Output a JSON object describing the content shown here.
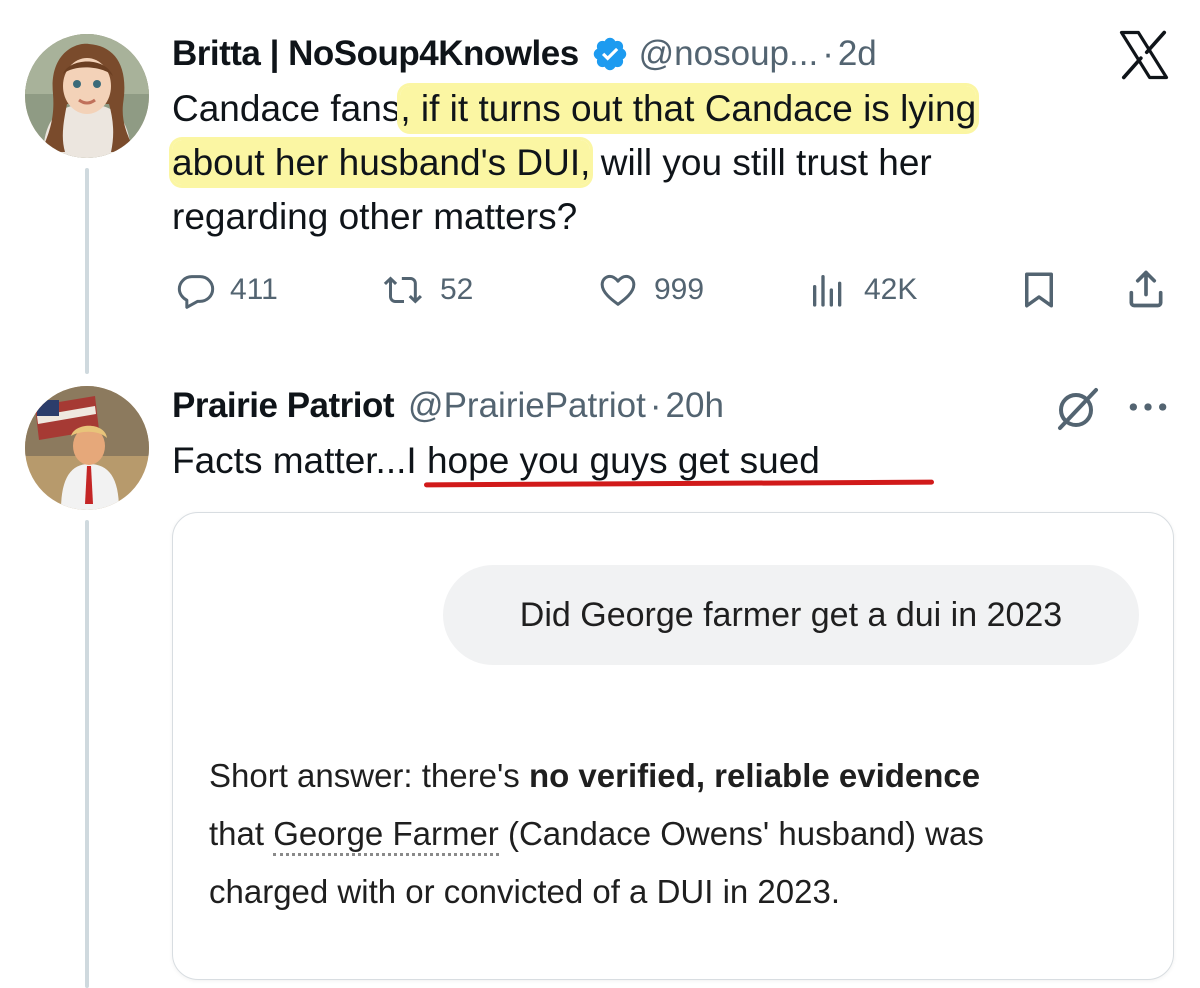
{
  "brand": {
    "logo": "X"
  },
  "tweet1": {
    "author_name": "Britta | NoSoup4Knowles",
    "handle": "@nosoup...",
    "separator": "·",
    "time": "2d",
    "verified": true,
    "text_part1": "Candace fans",
    "text_hl1": ", if it turns out that Candace is lying",
    "text_hl2": "about her husband's DUI,",
    "text_part2": " will you still trust her",
    "text_part3": "regarding other matters?",
    "stats": {
      "replies": "411",
      "reposts": "52",
      "likes": "999",
      "views": "42K"
    },
    "highlight_color": "#fbf6a3"
  },
  "tweet2": {
    "author_name": "Prairie Patriot",
    "handle": "@PrairiePatriot",
    "separator": "·",
    "time": "20h",
    "text_plain": "Facts matter...",
    "text_underlined": "I hope you guys get sued",
    "underline_color": "#d11a1a"
  },
  "chat_card": {
    "question": "Did George farmer get a dui in 2023",
    "answer_prefix": "Short answer: there's ",
    "answer_bold": "no verified, reliable evidence",
    "answer_line2_that": "that ",
    "answer_link": "George Farmer",
    "answer_line2_rest": " (Candace Owens' husband) was",
    "answer_line3": "charged with or convicted of a DUI in 2023."
  },
  "icons": {
    "verified": "verified-badge-icon",
    "reply": "reply-icon",
    "repost": "repost-icon",
    "like": "heart-icon",
    "views": "views-icon",
    "bookmark": "bookmark-icon",
    "share": "share-icon",
    "grok": "grok-icon",
    "more": "more-icon"
  },
  "colors": {
    "accent": "#1d9bf0",
    "muted": "#536471",
    "line": "#cfd9de"
  }
}
